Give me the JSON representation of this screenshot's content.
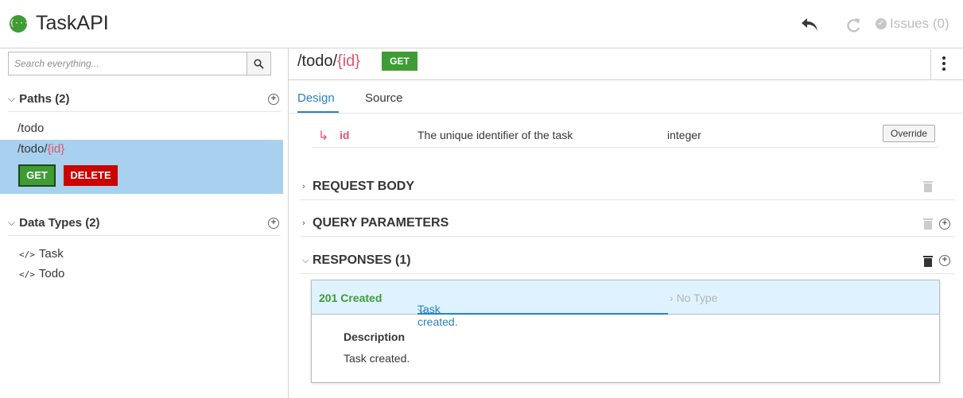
{
  "header": {
    "logo_glyph": "{···}",
    "app_title": "TaskAPI",
    "issues_label": "Issues (0)"
  },
  "sidebar": {
    "search_placeholder": "Search everything...",
    "paths_section": {
      "title": "Paths (2)"
    },
    "paths": [
      {
        "prefix": "/todo",
        "param": ""
      },
      {
        "prefix": "/todo/",
        "param": "{id}"
      }
    ],
    "selected_operations": {
      "get_label": "GET",
      "delete_label": "DELETE"
    },
    "data_types_section": {
      "title": "Data Types (2)"
    },
    "data_types": [
      {
        "icon": "</>",
        "label": "Task"
      },
      {
        "icon": "</>",
        "label": "Todo"
      }
    ]
  },
  "main": {
    "path_prefix": "/todo/",
    "path_param": "{id}",
    "method_badge": "GET",
    "tabs": [
      {
        "label": "Design",
        "active": true
      },
      {
        "label": "Source",
        "active": false
      }
    ],
    "path_parameter": {
      "name": "id",
      "description": "The unique identifier of the task",
      "type": "integer",
      "override_label": "Override"
    },
    "sections": [
      {
        "title": "REQUEST BODY",
        "expanded": false
      },
      {
        "title": "QUERY PARAMETERS",
        "expanded": false
      },
      {
        "title": "RESPONSES (1)",
        "expanded": true
      }
    ],
    "response": {
      "code": "201 Created",
      "description_summary": "Task created.",
      "type_summary": "No Type",
      "description_label": "Description",
      "description_text": "Task created."
    }
  },
  "colors": {
    "get_green": "#3f9c35",
    "delete_red": "#cc0000",
    "selection_blue": "#a7d1ee",
    "link_blue": "#2b80c2",
    "param_red": "#e9516f"
  }
}
